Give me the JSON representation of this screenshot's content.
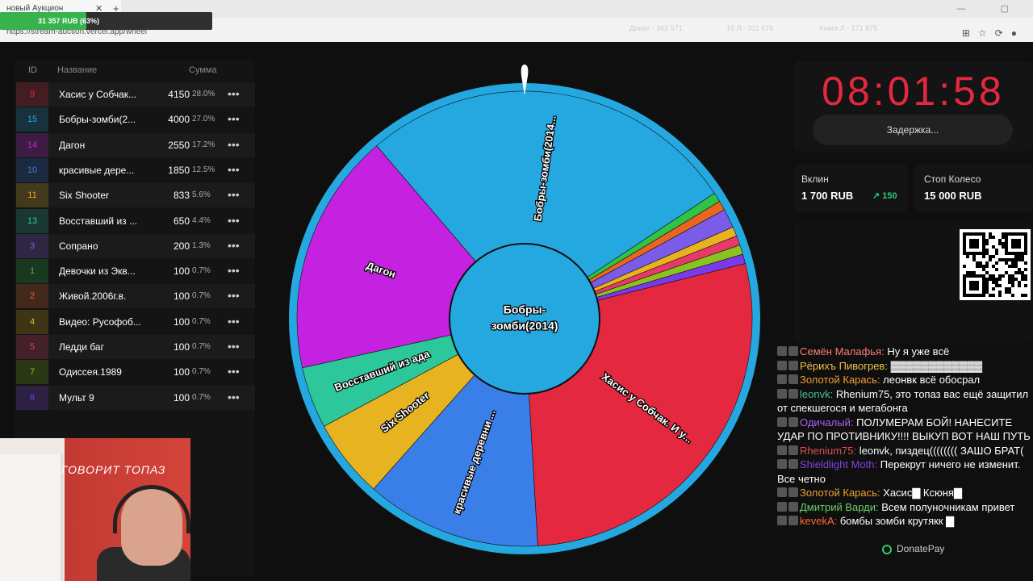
{
  "browser": {
    "tab_title": "новый Аукцион",
    "url": "https://stream-auction.vercel.app/wheel",
    "faded_top": "31 357  RUB",
    "faded_mid": "Донат - 362 571",
    "faded_mid2": "15 Л - 311 676",
    "faded_mid3": "Книга Л - 171 875"
  },
  "progress": {
    "text": "31 357  RUB (63%)",
    "percent": 63
  },
  "table": {
    "headers": {
      "id": "ID",
      "name": "Название",
      "sum": "Сумма"
    },
    "rows": [
      {
        "id": "9",
        "name": "Хасис у Собчак...",
        "amount": "4150",
        "pct": "28.0%",
        "color": "#e3283f"
      },
      {
        "id": "15",
        "name": "Бобры-зомби(2...",
        "amount": "4000",
        "pct": "27.0%",
        "color": "#25a8e0"
      },
      {
        "id": "14",
        "name": "Дагон",
        "amount": "2550",
        "pct": "17.2%",
        "color": "#c521e0"
      },
      {
        "id": "10",
        "name": "красивые дере...",
        "amount": "1850",
        "pct": "12.5%",
        "color": "#3a7ee8"
      },
      {
        "id": "11",
        "name": "Six Shooter",
        "amount": "833",
        "pct": "5.6%",
        "color": "#e8b320"
      },
      {
        "id": "13",
        "name": "Восставший из ...",
        "amount": "650",
        "pct": "4.4%",
        "color": "#2cc79a"
      },
      {
        "id": "3",
        "name": "Сопрано",
        "amount": "200",
        "pct": "1.3%",
        "color": "#7a5ce8"
      },
      {
        "id": "1",
        "name": "Девочки из Экв...",
        "amount": "100",
        "pct": "0.7%",
        "color": "#31c24a"
      },
      {
        "id": "2",
        "name": "Живой.2006г.в.",
        "amount": "100",
        "pct": "0.7%",
        "color": "#e8661f"
      },
      {
        "id": "4",
        "name": "Видео: Русофоб...",
        "amount": "100",
        "pct": "0.7%",
        "color": "#e8b320"
      },
      {
        "id": "5",
        "name": "Ледди баг",
        "amount": "100",
        "pct": "0.7%",
        "color": "#e83a6a"
      },
      {
        "id": "7",
        "name": "Одиссея.1989",
        "amount": "100",
        "pct": "0.7%",
        "color": "#8ac21f"
      },
      {
        "id": "8",
        "name": "Мульт 9",
        "amount": "100",
        "pct": "0.7%",
        "color": "#7a3ae8"
      }
    ]
  },
  "wheel": {
    "center_label_line1": "Бобры-",
    "center_label_line2": "зомби(2014)",
    "segments": [
      {
        "label": "Бобры-зомби(2014...",
        "value": 4000,
        "color": "#25a8e0"
      },
      {
        "label": "",
        "value": 100,
        "color": "#31c24a"
      },
      {
        "label": "",
        "value": 100,
        "color": "#e8661f"
      },
      {
        "label": "",
        "value": 200,
        "color": "#7a5ce8"
      },
      {
        "label": "",
        "value": 100,
        "color": "#e8b320"
      },
      {
        "label": "",
        "value": 100,
        "color": "#e83a6a"
      },
      {
        "label": "",
        "value": 100,
        "color": "#8ac21f"
      },
      {
        "label": "",
        "value": 100,
        "color": "#7a3ae8"
      },
      {
        "label": "Хасис у Собчак. И у...",
        "value": 4150,
        "color": "#e3283f"
      },
      {
        "label": "красивые деревни ...",
        "value": 1850,
        "color": "#3a7ee8"
      },
      {
        "label": "Six Shooter",
        "value": 833,
        "color": "#e8b320"
      },
      {
        "label": "Восставший из ада",
        "value": 650,
        "color": "#2cc79a"
      },
      {
        "label": "Дагон",
        "value": 2550,
        "color": "#c521e0"
      }
    ]
  },
  "timer": {
    "value": "08:01:58",
    "delay_label": "Задержка..."
  },
  "vklin": {
    "label": "Вклин",
    "value": "1 700 RUB",
    "delta": "150"
  },
  "stop": {
    "label": "Стоп Колесо",
    "value": "15 000 RUB"
  },
  "chat": [
    {
      "user": "Семён Малафья",
      "color": "#ff7b7b",
      "text": "Ну я уже всё"
    },
    {
      "user": "Рёрихъ Пивогрев",
      "color": "#f0c04a",
      "text": "▓▓▓▓▓▓▓▓▓▓▓▓"
    },
    {
      "user": "Золотой Карась",
      "color": "#f0a030",
      "text": "леонвк всё обосрал"
    },
    {
      "user": "leonvk",
      "color": "#45c08a",
      "text": "Rhenium75, это топаз вас ещё защитил от спекшегося и мегабонга"
    },
    {
      "user": "Одичалый",
      "color": "#b060f0",
      "text": "ПОЛУМЕРАМ БОЙ! НАНЕСИТЕ УДАР ПО ПРОТИВНИКУ!!!! ВЫКУП ВОТ НАШ ПУТЬ"
    },
    {
      "user": "Rhenium75",
      "color": "#e05050",
      "text": "leonvk, пиздец(((((((( ЗАШО БРАТ("
    },
    {
      "user": "Shieldlight Moth",
      "color": "#8040e0",
      "text": "Перекрут ничего не изменит. Все четно"
    },
    {
      "user": "Золотой Карась",
      "color": "#f0a030",
      "text": "Хасис▇ Ксюня▇"
    },
    {
      "user": "Дмитрий Варди",
      "color": "#6ad06a",
      "text": "Всем полуночникам привет"
    },
    {
      "user": "kevekA",
      "color": "#ff6a3a",
      "text": "бомбы зомби крутякк ▇"
    }
  ],
  "donate_label": "DonatePay",
  "cam_overlay": "ГОВОРИТ ТОПАЗ"
}
